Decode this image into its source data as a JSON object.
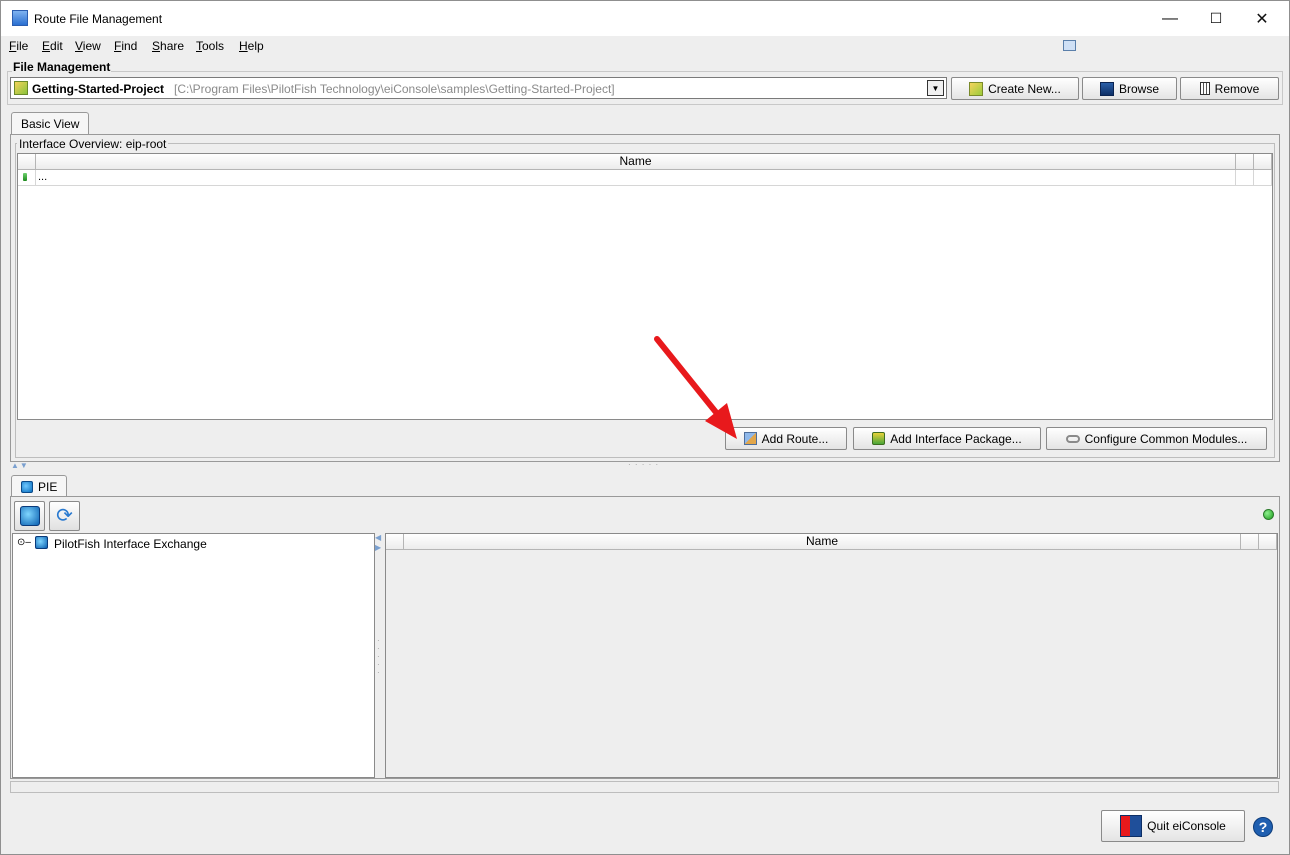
{
  "window": {
    "title": "Route File Management",
    "minimize": "—",
    "maximize": "☐",
    "close": "✕"
  },
  "menu": {
    "items": [
      {
        "label": "File",
        "mnemonic": "F",
        "rest": "ile"
      },
      {
        "label": "Edit",
        "mnemonic": "E",
        "rest": "dit"
      },
      {
        "label": "View",
        "mnemonic": "V",
        "rest": "iew"
      },
      {
        "label": "Find",
        "mnemonic": "F",
        "rest": "ind"
      },
      {
        "label": "Share",
        "mnemonic": "S",
        "rest": "hare"
      },
      {
        "label": "Tools",
        "mnemonic": "T",
        "rest": "ools"
      },
      {
        "label": "Help",
        "mnemonic": "H",
        "rest": "elp"
      }
    ]
  },
  "file_management": {
    "label": "File Management",
    "project_name": "Getting-Started-Project",
    "project_path": "[C:\\Program Files\\PilotFish Technology\\eiConsole\\samples\\Getting-Started-Project]",
    "create_new": "Create New...",
    "browse": "Browse",
    "remove": "Remove"
  },
  "basic_view": {
    "tab_label": "Basic View",
    "group_title": "Interface Overview: eip-root",
    "column_name": "Name",
    "rows": [
      {
        "name": "..."
      }
    ],
    "add_route": "Add Route...",
    "add_interface_package": "Add Interface Package...",
    "configure_common_modules": "Configure Common Modules..."
  },
  "pie": {
    "tab_label": "PIE",
    "tree_root": "PilotFish Interface Exchange",
    "column_name": "Name"
  },
  "footer": {
    "quit": "Quit eiConsole",
    "help": "?"
  },
  "colors": {
    "annotation_arrow": "#e8191c",
    "status_online": "#1a9a1a"
  }
}
